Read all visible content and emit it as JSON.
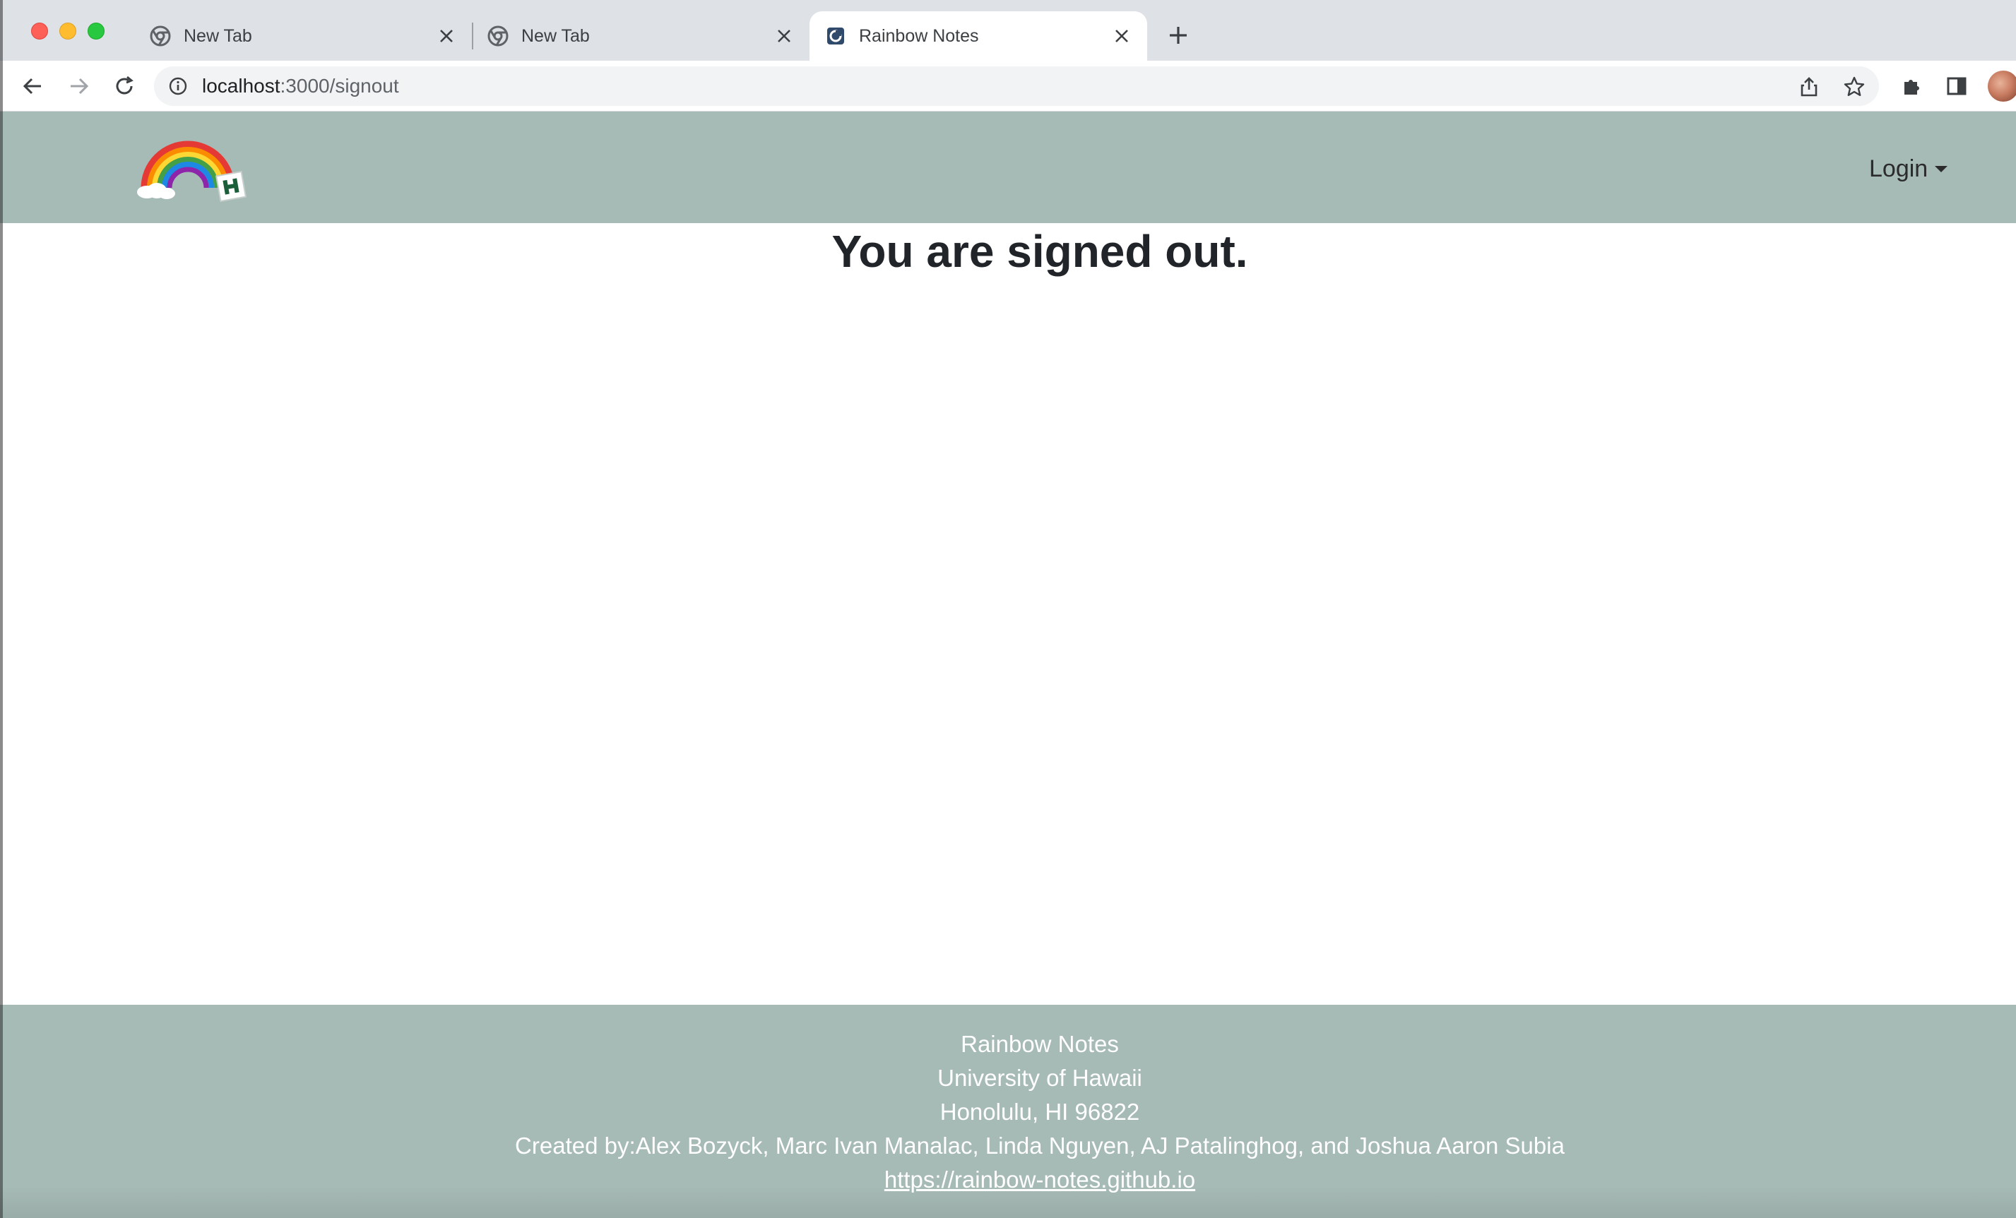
{
  "browser": {
    "tabs": [
      {
        "title": "New Tab",
        "favicon": "chrome-icon",
        "active": false
      },
      {
        "title": "New Tab",
        "favicon": "chrome-icon",
        "active": false
      },
      {
        "title": "Rainbow Notes",
        "favicon": "rainbow-notes-favicon",
        "active": true
      }
    ],
    "new_tab_label": "+",
    "url_host": "localhost",
    "url_path": ":3000/signout"
  },
  "app": {
    "nav": {
      "login_label": "Login"
    },
    "main": {
      "heading": "You are signed out."
    },
    "footer": {
      "name": "Rainbow Notes",
      "org": "University of Hawaii",
      "location": "Honolulu, HI 96822",
      "credits": "Created by:Alex Bozyck, Marc Ivan Manalac, Linda Nguyen, AJ Patalinghog, and Joshua Aaron Subia",
      "link": "https://rainbow-notes.github.io"
    },
    "colors": {
      "nav_bg": "#a6bab6",
      "footer_bg": "#a6bab6",
      "tab_strip_bg": "#dee1e6"
    }
  }
}
